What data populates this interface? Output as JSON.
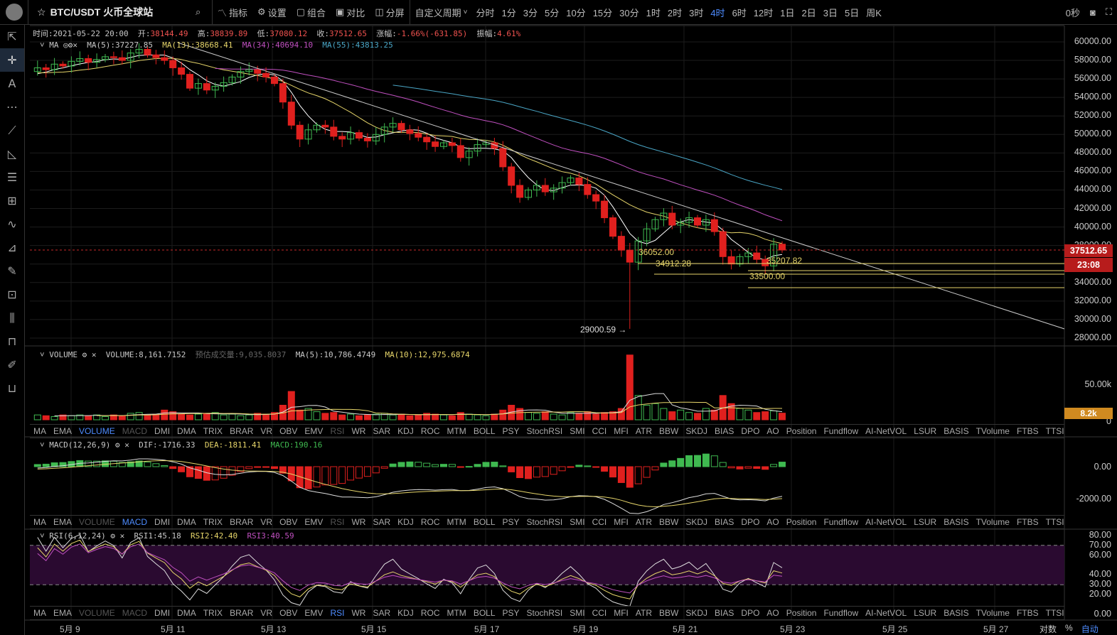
{
  "toolbar": {
    "symbol": "BTC/USDT 火币全球站",
    "indicators": "指标",
    "settings": "设置",
    "combo": "组合",
    "compare": "对比",
    "split": "分屏",
    "custom_period": "自定义周期",
    "periods": [
      "分时",
      "1分",
      "3分",
      "5分",
      "10分",
      "15分",
      "30分",
      "1时",
      "2时",
      "3时",
      "4时",
      "6时",
      "12时",
      "1日",
      "2日",
      "3日",
      "5日",
      "周K"
    ],
    "active_period": "4时",
    "countdown": "0秒"
  },
  "info": {
    "time_label": "时间:",
    "time": "2021-05-22 20:00",
    "open_label": "开:",
    "open": "38144.49",
    "high_label": "高:",
    "high": "38839.89",
    "low_label": "低:",
    "low": "37080.12",
    "close_label": "收:",
    "close": "37512.65",
    "change_label": "涨幅:",
    "change": "-1.66%(-631.85)",
    "amp_label": "振幅:",
    "amp": "4.61%"
  },
  "ma": {
    "name": "MA",
    "ma5": "MA(5):37227.85",
    "ma13": "MA(13):38668.41",
    "ma34": "MA(34):40694.10",
    "ma55": "MA(55):43813.25"
  },
  "volume": {
    "name": "VOLUME",
    "value": "VOLUME:8,161.7152",
    "est": "预估成交量:9,035.8037",
    "ma5": "MA(5):10,786.4749",
    "ma10": "MA(10):12,975.6874",
    "tag": "8.2k",
    "axis": [
      "50.00k",
      "0"
    ]
  },
  "macd": {
    "name": "MACD(12,26,9)",
    "dif": "DIF:-1716.33",
    "dea": "DEA:-1811.41",
    "macd": "MACD:190.16",
    "axis": [
      "0.00",
      "-2000.00"
    ]
  },
  "rsi": {
    "name": "RSI(6,12,24)",
    "rsi1": "RSI1:45.18",
    "rsi2": "RSI2:42.40",
    "rsi3": "RSI3:40.59",
    "axis": [
      "80.00",
      "70.00",
      "60.00",
      "40.00",
      "30.00",
      "20.00",
      "0.00"
    ]
  },
  "indicator_tabs": [
    "MA",
    "EMA",
    "VOLUME",
    "MACD",
    "DMI",
    "DMA",
    "TRIX",
    "BRAR",
    "VR",
    "OBV",
    "EMV",
    "RSI",
    "WR",
    "SAR",
    "KDJ",
    "ROC",
    "MTM",
    "BOLL",
    "PSY",
    "StochRSI",
    "SMI",
    "CCI",
    "MFI",
    "ATR",
    "BBW",
    "SKDJ",
    "BIAS",
    "DPO",
    "AO",
    "Position",
    "Fundflow",
    "AI-NetVOL",
    "LSUR",
    "BASIS",
    "TVolume",
    "FTBS",
    "TTSI"
  ],
  "price_axis": [
    "60000.00",
    "58000.00",
    "56000.00",
    "54000.00",
    "52000.00",
    "50000.00",
    "48000.00",
    "46000.00",
    "44000.00",
    "42000.00",
    "40000.00",
    "38000.00",
    "36000.00",
    "34000.00",
    "32000.00",
    "30000.00",
    "28000.00"
  ],
  "last_price": "37512.65",
  "last_countdown": "23:08",
  "annotations": [
    "36052.00",
    "34912.28",
    "35207.82",
    "33500.00",
    "29000.59 →"
  ],
  "dates": [
    "5月 9",
    "5月 11",
    "5月 13",
    "5月 15",
    "5月 17",
    "5月 19",
    "5月 21",
    "5月 23",
    "5月 25",
    "5月 27"
  ],
  "axis_options": {
    "log": "对数",
    "pct": "%",
    "auto": "自动"
  },
  "colors": {
    "up": "#3fb950",
    "down": "#e0201e",
    "accent": "#4e8cff",
    "ma5": "#ffffff",
    "ma13": "#e6d56a",
    "ma34": "#c050c0",
    "ma55": "#4aa6c6",
    "last_price_bg": "#b71c1c",
    "volume_tag_bg": "#d08a20",
    "rsi_band": "#2a0a30"
  },
  "chart_data": {
    "type": "candlestick",
    "interval": "4h",
    "last_time": "2021-05-22 20:00",
    "close": [
      56500,
      56800,
      57200,
      57000,
      57600,
      57400,
      57900,
      58200,
      57800,
      58100,
      58400,
      58300,
      58000,
      58800,
      59200,
      58600,
      58300,
      58000,
      57200,
      56500,
      55000,
      55500,
      54800,
      55200,
      55600,
      56200,
      56800,
      57000,
      56600,
      56200,
      55500,
      53500,
      51000,
      49500,
      50500,
      51000,
      50800,
      49800,
      49500,
      50200,
      49600,
      49300,
      50000,
      50800,
      51200,
      50500,
      50100,
      49700,
      49200,
      48700,
      49100,
      48800,
      47500,
      48200,
      48900,
      49100,
      48500,
      46500,
      44500,
      43200,
      44000,
      44500,
      43800,
      44200,
      44800,
      45300,
      44600,
      43500,
      42800,
      41000,
      39000,
      37500,
      36200,
      38500,
      39800,
      40800,
      41500,
      40200,
      40500,
      41000,
      40200,
      40800,
      39500,
      36800,
      36000,
      36800,
      37200,
      36500,
      35800,
      38144,
      37512
    ],
    "volume": [
      5,
      4,
      6,
      5,
      4,
      6,
      5,
      6,
      5,
      6,
      4,
      6,
      5,
      8,
      9,
      6,
      7,
      12,
      10,
      7,
      6,
      7,
      8,
      9,
      6,
      7,
      5,
      6,
      8,
      7,
      9,
      18,
      35,
      12,
      14,
      10,
      8,
      9,
      6,
      7,
      5,
      6,
      7,
      8,
      6,
      7,
      5,
      6,
      8,
      7,
      6,
      5,
      9,
      7,
      6,
      5,
      7,
      12,
      18,
      14,
      9,
      8,
      10,
      7,
      6,
      9,
      8,
      10,
      7,
      9,
      10,
      14,
      80,
      30,
      18,
      20,
      14,
      10,
      12,
      9,
      8,
      14,
      12,
      30,
      20,
      14,
      12,
      9,
      10,
      11,
      8.2
    ],
    "ylim": [
      28000,
      60000
    ]
  }
}
